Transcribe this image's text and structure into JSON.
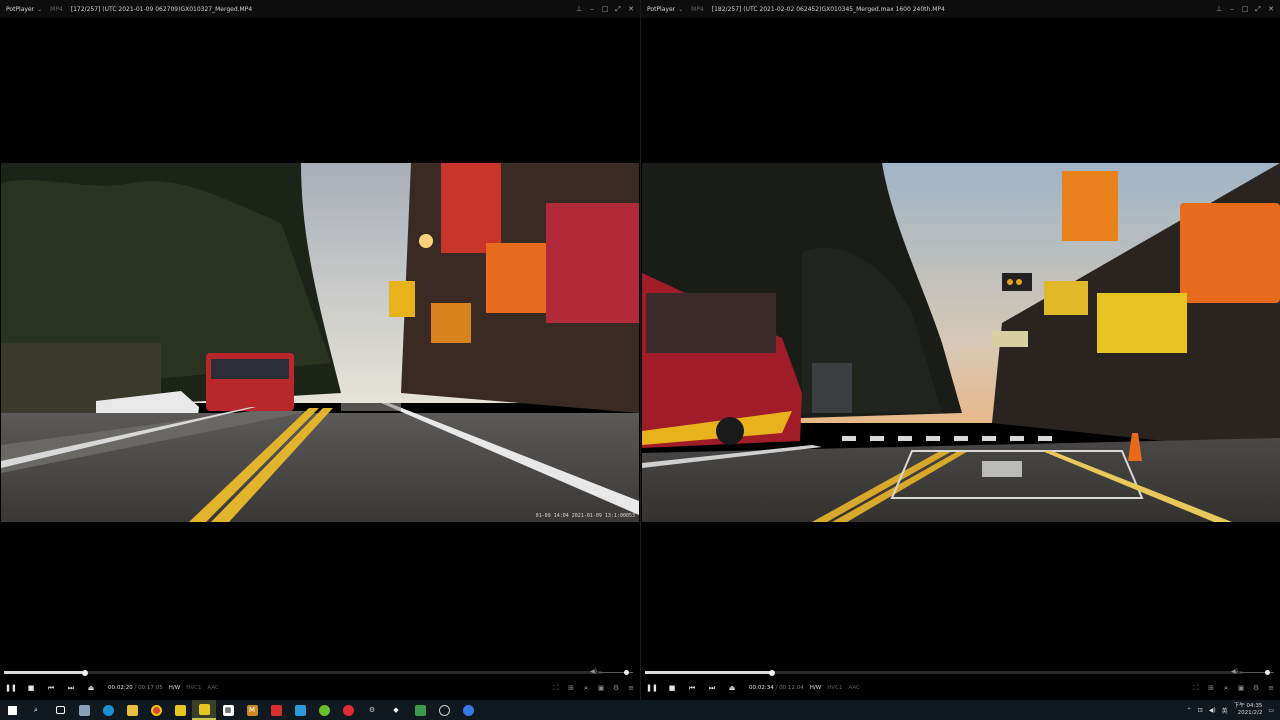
{
  "players": [
    {
      "app_name": "PotPlayer",
      "format": "MP4",
      "title": "[172/257] (UTC 2021-01-09 062709)GX010327_Merged.MP4",
      "osd_stamp": "01-09 14:04  2021-01-09  13:1:00053",
      "current_time": "00:02:20",
      "separator": "/",
      "total_time": "00:17:05",
      "hw_label": "H/W",
      "codec_video": "HVC1",
      "codec_audio": "AAC",
      "progress": 0.136,
      "volume": 0.8
    },
    {
      "app_name": "PotPlayer",
      "format": "MP4",
      "title": "[182/257] (UTC 2021-02-02 062452)GX010345_Merged.max 1600 240th.MP4",
      "osd_stamp": "",
      "current_time": "00:02:34",
      "separator": "/",
      "total_time": "00:12:04",
      "hw_label": "H/W",
      "codec_video": "HVC1",
      "codec_audio": "AAC",
      "progress": 0.213,
      "volume": 0.8
    }
  ],
  "taskbar": {
    "icons": [
      "windows-start-icon",
      "search-icon",
      "task-view-icon",
      "recycle-bin-icon",
      "edge-icon",
      "file-explorer-icon",
      "chrome-icon",
      "potplayer-icon",
      "potplayer-active-icon",
      "calendar-icon",
      "app-m-icon",
      "app-red-icon",
      "photos-icon",
      "app-green-icon",
      "app-redcircle-icon",
      "app-gear-icon",
      "app-shield-icon",
      "app-green2-icon",
      "app-clock-icon",
      "app-blue-icon"
    ],
    "clock_time": "下午 04:35",
    "clock_date": "2021/2/2"
  }
}
